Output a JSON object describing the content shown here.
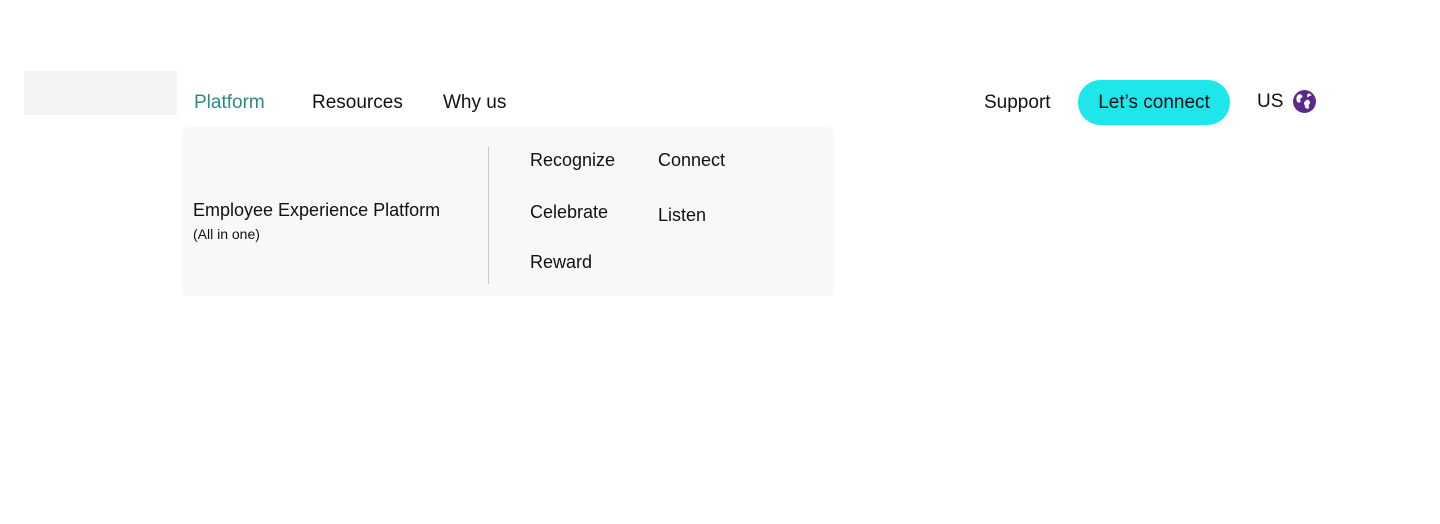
{
  "nav": {
    "items": [
      {
        "label": "Platform",
        "active": true
      },
      {
        "label": "Resources",
        "active": false
      },
      {
        "label": "Why us",
        "active": false
      }
    ]
  },
  "header": {
    "support_label": "Support",
    "connect_label": "Let’s connect",
    "region_label": "US",
    "region_icon": "globe-icon"
  },
  "dropdown": {
    "main_title": "Employee Experience Platform",
    "main_subtitle": "(All in one)",
    "links": [
      {
        "label": "Recognize"
      },
      {
        "label": "Celebrate"
      },
      {
        "label": "Reward"
      },
      {
        "label": "Connect"
      },
      {
        "label": "Listen"
      }
    ]
  },
  "colors": {
    "accent_active": "#2a8a86",
    "button_bg": "#1ee6ea",
    "globe": "#5a2a8a",
    "dropdown_bg": "#f6f9f8"
  }
}
